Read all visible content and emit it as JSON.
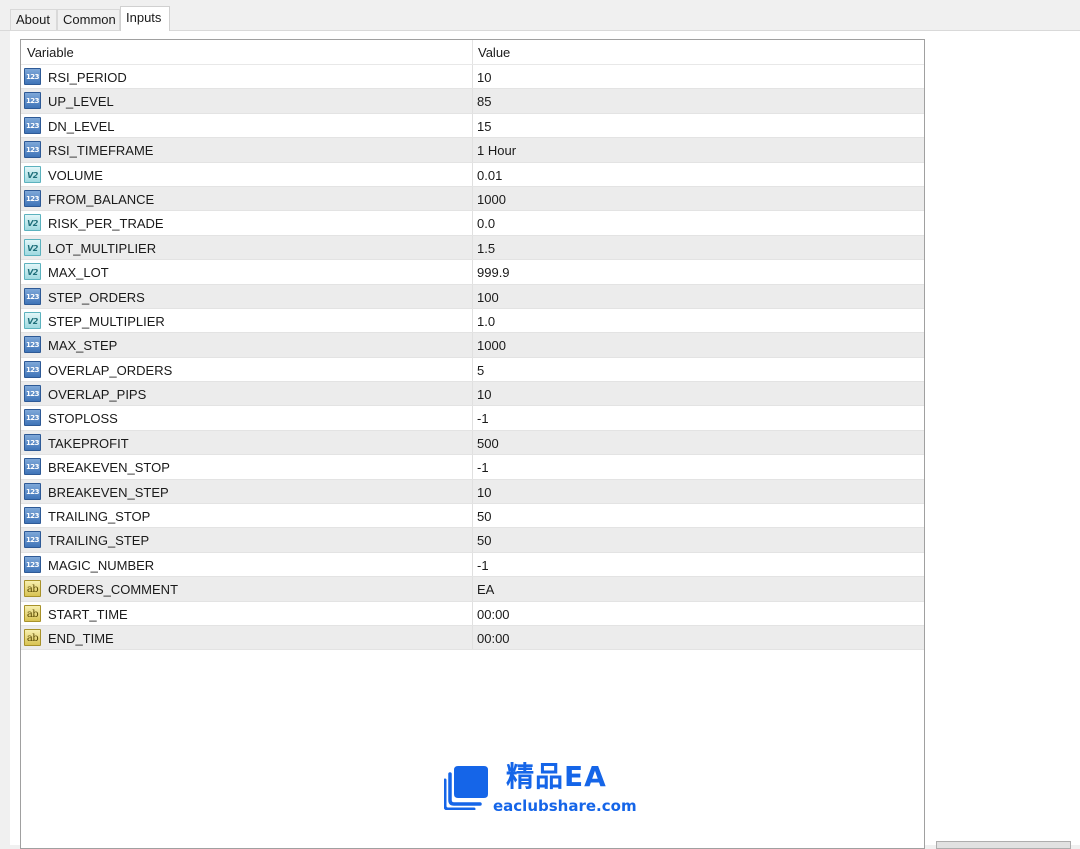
{
  "tabs": [
    {
      "label": "About"
    },
    {
      "label": "Common"
    },
    {
      "label": "Inputs"
    }
  ],
  "active_tab": "Inputs",
  "table": {
    "columns": {
      "variable": "Variable",
      "value": "Value"
    },
    "rows": [
      {
        "type": "int",
        "name": "RSI_PERIOD",
        "value": "10"
      },
      {
        "type": "int",
        "name": "UP_LEVEL",
        "value": "85"
      },
      {
        "type": "int",
        "name": "DN_LEVEL",
        "value": "15"
      },
      {
        "type": "int",
        "name": "RSI_TIMEFRAME",
        "value": "1 Hour"
      },
      {
        "type": "double",
        "name": "VOLUME",
        "value": "0.01"
      },
      {
        "type": "int",
        "name": "FROM_BALANCE",
        "value": "1000"
      },
      {
        "type": "double",
        "name": "RISK_PER_TRADE",
        "value": "0.0"
      },
      {
        "type": "double",
        "name": "LOT_MULTIPLIER",
        "value": "1.5"
      },
      {
        "type": "double",
        "name": "MAX_LOT",
        "value": "999.9"
      },
      {
        "type": "int",
        "name": "STEP_ORDERS",
        "value": "100"
      },
      {
        "type": "double",
        "name": "STEP_MULTIPLIER",
        "value": "1.0"
      },
      {
        "type": "int",
        "name": "MAX_STEP",
        "value": "1000"
      },
      {
        "type": "int",
        "name": "OVERLAP_ORDERS",
        "value": "5"
      },
      {
        "type": "int",
        "name": "OVERLAP_PIPS",
        "value": "10"
      },
      {
        "type": "int",
        "name": "STOPLOSS",
        "value": "-1"
      },
      {
        "type": "int",
        "name": "TAKEPROFIT",
        "value": "500"
      },
      {
        "type": "int",
        "name": "BREAKEVEN_STOP",
        "value": "-1"
      },
      {
        "type": "int",
        "name": "BREAKEVEN_STEP",
        "value": "10"
      },
      {
        "type": "int",
        "name": "TRAILING_STOP",
        "value": "50"
      },
      {
        "type": "int",
        "name": "TRAILING_STEP",
        "value": "50"
      },
      {
        "type": "int",
        "name": "MAGIC_NUMBER",
        "value": "-1"
      },
      {
        "type": "string",
        "name": "ORDERS_COMMENT",
        "value": "EA"
      },
      {
        "type": "string",
        "name": "START_TIME",
        "value": "00:00"
      },
      {
        "type": "string",
        "name": "END_TIME",
        "value": "00:00"
      }
    ]
  },
  "type_icons": {
    "int": {
      "glyph": "123",
      "icon": "integer-type-icon"
    },
    "double": {
      "glyph": "V2",
      "icon": "double-type-icon"
    },
    "string": {
      "glyph": "ab",
      "icon": "string-type-icon"
    }
  },
  "watermark": {
    "title": "精品EA",
    "url": "eaclubshare.com",
    "color": "#1565e8"
  }
}
